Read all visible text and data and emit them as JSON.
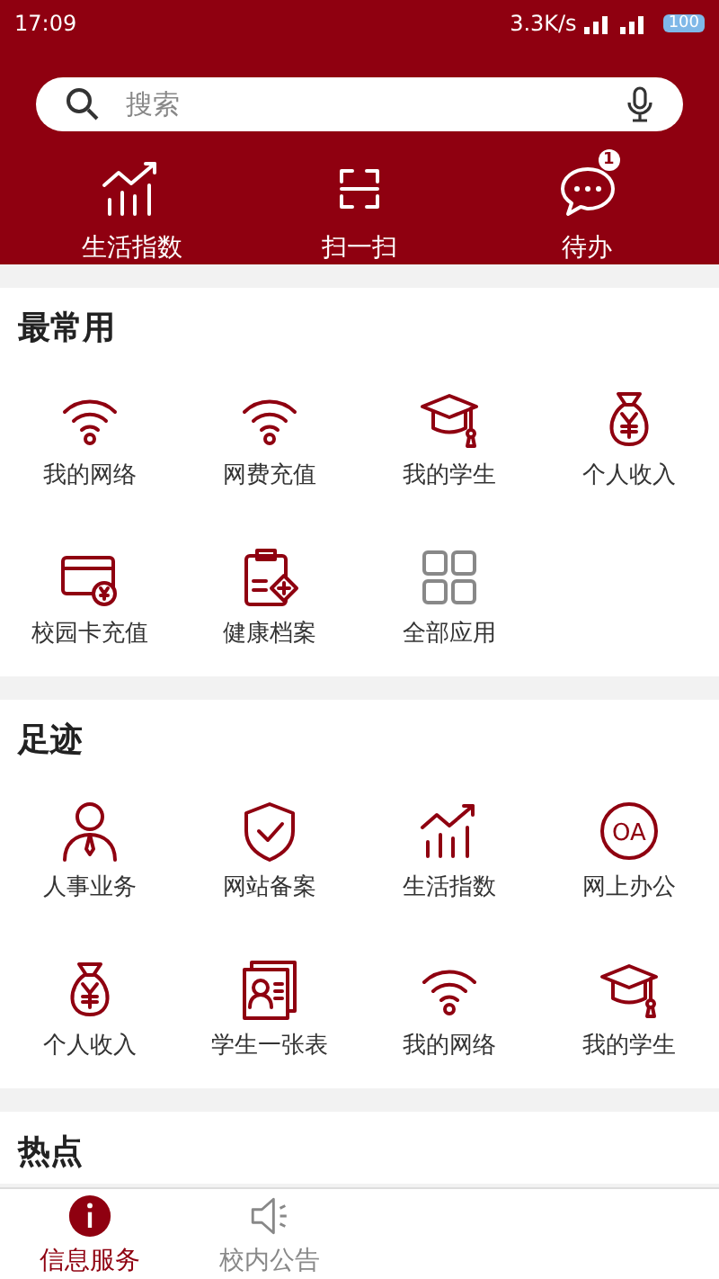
{
  "status_bar": {
    "time": "17:09",
    "speed": "3.3K/s",
    "battery": "100"
  },
  "search": {
    "placeholder": "搜索"
  },
  "quick_actions": [
    {
      "kind": "chart",
      "label": "生活指数"
    },
    {
      "kind": "scan",
      "label": "扫一扫"
    },
    {
      "kind": "chat",
      "label": "待办",
      "badge": "1"
    }
  ],
  "sections": [
    {
      "title": "最常用",
      "items": [
        {
          "kind": "wifi",
          "label": "我的网络"
        },
        {
          "kind": "wifi",
          "label": "网费充值"
        },
        {
          "kind": "cap",
          "label": "我的学生"
        },
        {
          "kind": "bag",
          "label": "个人收入"
        },
        {
          "kind": "card",
          "label": "校园卡充值"
        },
        {
          "kind": "clipboard",
          "label": "健康档案"
        },
        {
          "kind": "grid",
          "label": "全部应用"
        }
      ]
    },
    {
      "title": "足迹",
      "items": [
        {
          "kind": "person",
          "label": "人事业务"
        },
        {
          "kind": "shield",
          "label": "网站备案"
        },
        {
          "kind": "chart",
          "label": "生活指数"
        },
        {
          "kind": "oa",
          "label": "网上办公",
          "icon_text": "OA"
        },
        {
          "kind": "bag",
          "label": "个人收入"
        },
        {
          "kind": "idcard",
          "label": "学生一张表"
        },
        {
          "kind": "wifi",
          "label": "我的网络"
        },
        {
          "kind": "cap",
          "label": "我的学生"
        }
      ]
    },
    {
      "title": "热点"
    }
  ],
  "bottom_nav": [
    {
      "kind": "info",
      "label": "信息服务",
      "selected": true
    },
    {
      "kind": "speaker",
      "label": "校内公告",
      "selected": false
    }
  ]
}
